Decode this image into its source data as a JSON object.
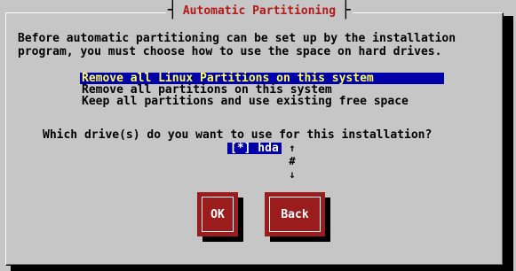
{
  "dialog": {
    "title": "Automatic Partitioning",
    "intro": "Before automatic partitioning can be set up by the installation\nprogram, you must choose how to use the space on hard drives."
  },
  "partition_options": {
    "items": [
      {
        "label": "Remove all Linux Partitions on this system",
        "selected": true
      },
      {
        "label": "Remove all partitions on this system",
        "selected": false
      },
      {
        "label": "Keep all partitions and use existing free space",
        "selected": false
      }
    ]
  },
  "drives": {
    "question": "Which drive(s) do you want to use for this installation?",
    "items": [
      {
        "label": "[*] hda",
        "checked": true
      }
    ],
    "scroll_up": "↑",
    "scroll_thumb": "#",
    "scroll_down": "↓"
  },
  "buttons": {
    "ok": "OK",
    "back": "Back"
  },
  "colors": {
    "background": "#c6c6c6",
    "title": "#b41818",
    "selection_bg": "#0000a8",
    "selection_fg": "#ffff54",
    "button_bg": "#9a1c1c"
  }
}
